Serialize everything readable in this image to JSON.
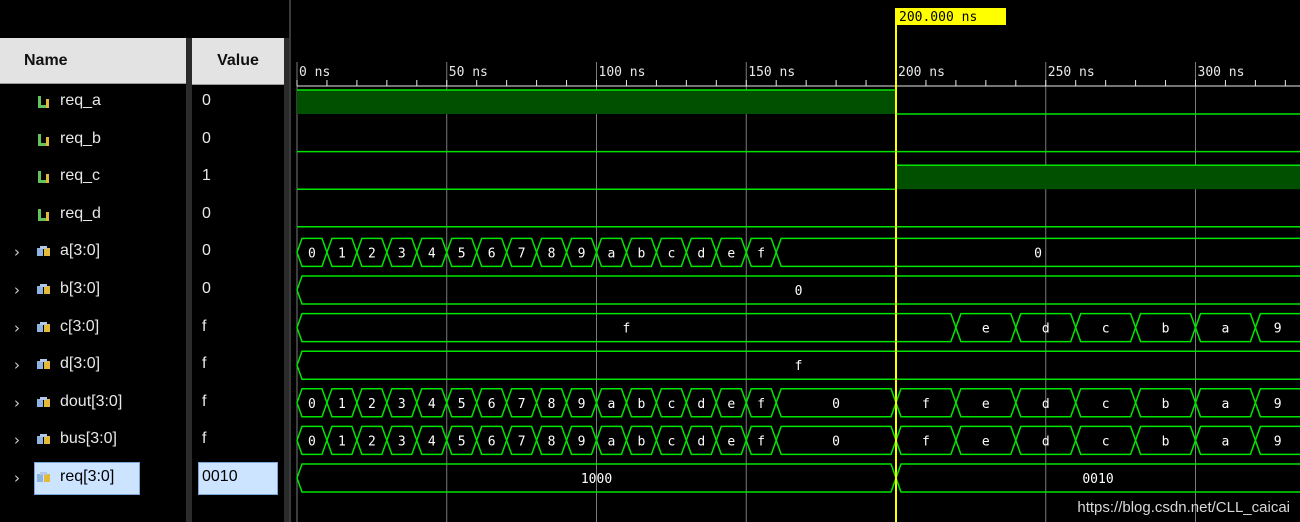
{
  "columns": {
    "name": "Name",
    "value": "Value"
  },
  "signals": [
    {
      "name": "req_a",
      "value": "0",
      "kind": "bit",
      "expandable": false,
      "selected": false
    },
    {
      "name": "req_b",
      "value": "0",
      "kind": "bit",
      "expandable": false,
      "selected": false
    },
    {
      "name": "req_c",
      "value": "1",
      "kind": "bit",
      "expandable": false,
      "selected": false
    },
    {
      "name": "req_d",
      "value": "0",
      "kind": "bit",
      "expandable": false,
      "selected": false
    },
    {
      "name": "a[3:0]",
      "value": "0",
      "kind": "bus",
      "expandable": true,
      "selected": false
    },
    {
      "name": "b[3:0]",
      "value": "0",
      "kind": "bus",
      "expandable": true,
      "selected": false
    },
    {
      "name": "c[3:0]",
      "value": "f",
      "kind": "bus",
      "expandable": true,
      "selected": false
    },
    {
      "name": "d[3:0]",
      "value": "f",
      "kind": "bus",
      "expandable": true,
      "selected": false
    },
    {
      "name": "dout[3:0]",
      "value": "f",
      "kind": "bus",
      "expandable": true,
      "selected": false
    },
    {
      "name": "bus[3:0]",
      "value": "f",
      "kind": "bus",
      "expandable": true,
      "selected": false
    },
    {
      "name": "req[3:0]",
      "value": "0010",
      "kind": "bus",
      "expandable": true,
      "selected": true
    }
  ],
  "timeline": {
    "cursor_ns": 200,
    "cursor_label": "200.000 ns",
    "ticks": [
      {
        "ns": 0,
        "label": "0 ns"
      },
      {
        "ns": 50,
        "label": "50 ns"
      },
      {
        "ns": 100,
        "label": "100 ns"
      },
      {
        "ns": 150,
        "label": "150 ns"
      },
      {
        "ns": 200,
        "label": "200 ns"
      },
      {
        "ns": 250,
        "label": "250 ns"
      },
      {
        "ns": 300,
        "label": "300 ns"
      }
    ]
  },
  "waves": [
    {
      "type": "bit",
      "segments": [
        {
          "start": 0,
          "end": 200,
          "v": 1
        },
        {
          "start": 200,
          "end": 336,
          "v": 0
        }
      ]
    },
    {
      "type": "bit",
      "segments": [
        {
          "start": 0,
          "end": 336,
          "v": 0
        }
      ]
    },
    {
      "type": "bit",
      "segments": [
        {
          "start": 0,
          "end": 200,
          "v": 0
        },
        {
          "start": 200,
          "end": 336,
          "v": 1
        }
      ]
    },
    {
      "type": "bit",
      "segments": [
        {
          "start": 0,
          "end": 336,
          "v": 0
        }
      ]
    },
    {
      "type": "bus",
      "segments": [
        {
          "start": 0,
          "end": 10,
          "v": "0"
        },
        {
          "start": 10,
          "end": 20,
          "v": "1"
        },
        {
          "start": 20,
          "end": 30,
          "v": "2"
        },
        {
          "start": 30,
          "end": 40,
          "v": "3"
        },
        {
          "start": 40,
          "end": 50,
          "v": "4"
        },
        {
          "start": 50,
          "end": 60,
          "v": "5"
        },
        {
          "start": 60,
          "end": 70,
          "v": "6"
        },
        {
          "start": 70,
          "end": 80,
          "v": "7"
        },
        {
          "start": 80,
          "end": 90,
          "v": "8"
        },
        {
          "start": 90,
          "end": 100,
          "v": "9"
        },
        {
          "start": 100,
          "end": 110,
          "v": "a"
        },
        {
          "start": 110,
          "end": 120,
          "v": "b"
        },
        {
          "start": 120,
          "end": 130,
          "v": "c"
        },
        {
          "start": 130,
          "end": 140,
          "v": "d"
        },
        {
          "start": 140,
          "end": 150,
          "v": "e"
        },
        {
          "start": 150,
          "end": 160,
          "v": "f"
        },
        {
          "start": 160,
          "end": 336,
          "v": "0"
        }
      ]
    },
    {
      "type": "bus",
      "segments": [
        {
          "start": 0,
          "end": 336,
          "v": "0"
        }
      ]
    },
    {
      "type": "bus",
      "segments": [
        {
          "start": 0,
          "end": 220,
          "v": "f"
        },
        {
          "start": 220,
          "end": 240,
          "v": "e"
        },
        {
          "start": 240,
          "end": 260,
          "v": "d"
        },
        {
          "start": 260,
          "end": 280,
          "v": "c"
        },
        {
          "start": 280,
          "end": 300,
          "v": "b"
        },
        {
          "start": 300,
          "end": 320,
          "v": "a"
        },
        {
          "start": 320,
          "end": 340,
          "v": "9"
        }
      ]
    },
    {
      "type": "bus",
      "segments": [
        {
          "start": 0,
          "end": 336,
          "v": "f"
        }
      ]
    },
    {
      "type": "bus",
      "segments": [
        {
          "start": 0,
          "end": 10,
          "v": "0"
        },
        {
          "start": 10,
          "end": 20,
          "v": "1"
        },
        {
          "start": 20,
          "end": 30,
          "v": "2"
        },
        {
          "start": 30,
          "end": 40,
          "v": "3"
        },
        {
          "start": 40,
          "end": 50,
          "v": "4"
        },
        {
          "start": 50,
          "end": 60,
          "v": "5"
        },
        {
          "start": 60,
          "end": 70,
          "v": "6"
        },
        {
          "start": 70,
          "end": 80,
          "v": "7"
        },
        {
          "start": 80,
          "end": 90,
          "v": "8"
        },
        {
          "start": 90,
          "end": 100,
          "v": "9"
        },
        {
          "start": 100,
          "end": 110,
          "v": "a"
        },
        {
          "start": 110,
          "end": 120,
          "v": "b"
        },
        {
          "start": 120,
          "end": 130,
          "v": "c"
        },
        {
          "start": 130,
          "end": 140,
          "v": "d"
        },
        {
          "start": 140,
          "end": 150,
          "v": "e"
        },
        {
          "start": 150,
          "end": 160,
          "v": "f"
        },
        {
          "start": 160,
          "end": 200,
          "v": "0"
        },
        {
          "start": 200,
          "end": 220,
          "v": "f"
        },
        {
          "start": 220,
          "end": 240,
          "v": "e"
        },
        {
          "start": 240,
          "end": 260,
          "v": "d"
        },
        {
          "start": 260,
          "end": 280,
          "v": "c"
        },
        {
          "start": 280,
          "end": 300,
          "v": "b"
        },
        {
          "start": 300,
          "end": 320,
          "v": "a"
        },
        {
          "start": 320,
          "end": 340,
          "v": "9"
        }
      ]
    },
    {
      "type": "bus",
      "segments": [
        {
          "start": 0,
          "end": 10,
          "v": "0"
        },
        {
          "start": 10,
          "end": 20,
          "v": "1"
        },
        {
          "start": 20,
          "end": 30,
          "v": "2"
        },
        {
          "start": 30,
          "end": 40,
          "v": "3"
        },
        {
          "start": 40,
          "end": 50,
          "v": "4"
        },
        {
          "start": 50,
          "end": 60,
          "v": "5"
        },
        {
          "start": 60,
          "end": 70,
          "v": "6"
        },
        {
          "start": 70,
          "end": 80,
          "v": "7"
        },
        {
          "start": 80,
          "end": 90,
          "v": "8"
        },
        {
          "start": 90,
          "end": 100,
          "v": "9"
        },
        {
          "start": 100,
          "end": 110,
          "v": "a"
        },
        {
          "start": 110,
          "end": 120,
          "v": "b"
        },
        {
          "start": 120,
          "end": 130,
          "v": "c"
        },
        {
          "start": 130,
          "end": 140,
          "v": "d"
        },
        {
          "start": 140,
          "end": 150,
          "v": "e"
        },
        {
          "start": 150,
          "end": 160,
          "v": "f"
        },
        {
          "start": 160,
          "end": 200,
          "v": "0"
        },
        {
          "start": 200,
          "end": 220,
          "v": "f"
        },
        {
          "start": 220,
          "end": 240,
          "v": "e"
        },
        {
          "start": 240,
          "end": 260,
          "v": "d"
        },
        {
          "start": 260,
          "end": 280,
          "v": "c"
        },
        {
          "start": 280,
          "end": 300,
          "v": "b"
        },
        {
          "start": 300,
          "end": 320,
          "v": "a"
        },
        {
          "start": 320,
          "end": 340,
          "v": "9"
        }
      ]
    },
    {
      "type": "bus",
      "segments": [
        {
          "start": 0,
          "end": 200,
          "v": "1000"
        },
        {
          "start": 200,
          "end": 336,
          "v": "0010"
        }
      ]
    }
  ],
  "colors": {
    "wave": "#00e600",
    "wave_high": "#005000",
    "cursor": "#ffff00",
    "grid": "#7a7a7a"
  },
  "watermark": "https://blog.csdn.net/CLL_caicai"
}
